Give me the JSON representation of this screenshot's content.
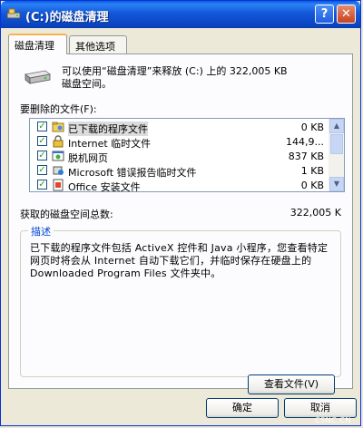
{
  "window": {
    "title": "(C:)的磁盘清理",
    "help_label": "?",
    "close_label": "✕"
  },
  "tabs": [
    {
      "label": "磁盘清理",
      "active": true
    },
    {
      "label": "其他选项",
      "active": false
    }
  ],
  "summary": {
    "line1": "可以使用“磁盘清理”来释放 (C:) 上的 322,005 KB",
    "line2": "磁盘空间。"
  },
  "file_list": {
    "label": "要删除的文件(F):",
    "items": [
      {
        "icon": "folder-icon",
        "name": "已下载的程序文件",
        "size": "0 KB",
        "checked": true
      },
      {
        "icon": "lock-icon",
        "name": "Internet 临时文件",
        "size": "144,9...",
        "checked": true
      },
      {
        "icon": "offline-page-icon",
        "name": "脱机网页",
        "size": "837 KB",
        "checked": true
      },
      {
        "icon": "error-report-icon",
        "name": "Microsoft 错误报告临时文件",
        "size": "1 KB",
        "checked": true
      },
      {
        "icon": "office-icon",
        "name": "Office 安装文件",
        "size": "0 KB",
        "checked": true
      }
    ]
  },
  "total": {
    "label": "获取的磁盘空间总数:",
    "value": "322,005 K"
  },
  "description": {
    "legend": "描述",
    "text": "已下载的程序文件包括 ActiveX 控件和 Java 小程序，您查看特定网页时将会从 Internet 自动下载它们，并临时保存在硬盘上的 Downloaded Program Files 文件夹中。",
    "view_button": "查看文件(V)"
  },
  "footer": {
    "ok_label": "确定",
    "cancel_label": "取消"
  },
  "watermark": "CSNC.CN",
  "colors": {
    "titlebar": "#0b46c4",
    "accent_tab": "#f9b34c",
    "legend_text": "#0046d5",
    "check": "#21a121"
  }
}
